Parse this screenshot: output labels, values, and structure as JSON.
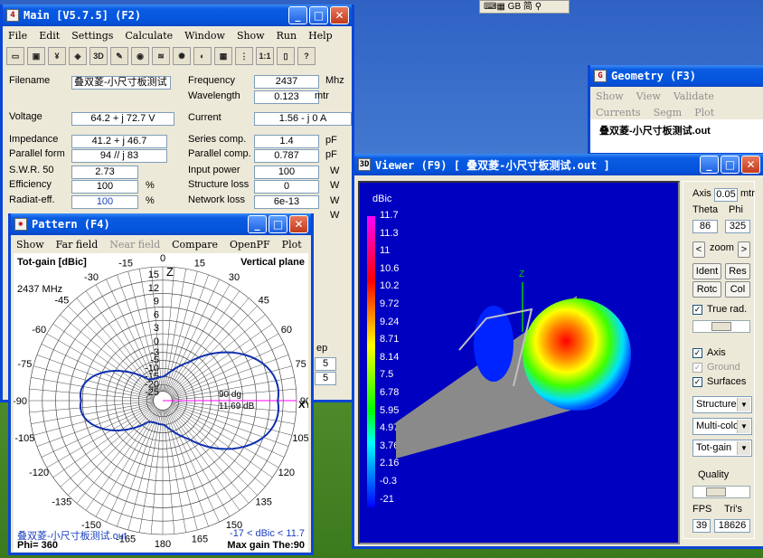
{
  "desktop": {
    "toolbar_text": "GB 简"
  },
  "main": {
    "title": "Main  [V5.7.5]    (F2)",
    "menu": [
      "File",
      "Edit",
      "Settings",
      "Calculate",
      "Window",
      "Show",
      "Run",
      "Help"
    ],
    "tools": [
      "open",
      "save",
      "ant",
      "box",
      "3D",
      "edit",
      "info",
      "wave",
      "pat",
      "map",
      "calc",
      "grid",
      "1:1",
      "book",
      "help"
    ],
    "filename_label": "Filename",
    "filename": "叠双菱-小尺寸板测试",
    "frequency_label": "Frequency",
    "frequency": "2437",
    "frequency_unit": "Mhz",
    "wavelength_label": "Wavelength",
    "wavelength": "0.123",
    "wavelength_unit": "mtr",
    "voltage_label": "Voltage",
    "voltage": "64.2 + j 72.7 V",
    "current_label": "Current",
    "current": "1.56 - j 0 A",
    "impedance_label": "Impedance",
    "impedance": "41.2 + j 46.7",
    "series_label": "Series comp.",
    "series": "1.4",
    "series_unit": "pF",
    "parallel_form_label": "Parallel form",
    "parallel_form": "94 // j 83",
    "parallel_comp_label": "Parallel comp.",
    "parallel_comp": "0.787",
    "parallel_unit": "pF",
    "swr_label": "S.W.R. 50",
    "swr": "2.73",
    "input_power_label": "Input power",
    "input_power": "100",
    "input_power_unit": "W",
    "efficiency_label": "Efficiency",
    "efficiency": "100",
    "efficiency_unit": "%",
    "structure_loss_label": "Structure loss",
    "structure_loss": "0",
    "structure_loss_unit": "W",
    "radiat_label": "Radiat-eff.",
    "radiat": "100",
    "radiat_unit": "%",
    "network_loss_label": "Network loss",
    "network_loss": "6e-13",
    "network_loss_unit": "W",
    "extra_unit": "W",
    "ep_label": "ep",
    "val5a": "5",
    "val5b": "5"
  },
  "geometry": {
    "title": "Geometry    (F3)",
    "menu": [
      "Show",
      "View",
      "Validate",
      "Currents",
      "Segm",
      "Plot"
    ],
    "file": "叠双菱-小尺寸板测试.out"
  },
  "viewer": {
    "title": "Viewer  (F9)      [  叠双菱-小尺寸板测试.out  ]",
    "scale_label": "dBic",
    "scale": [
      "11.7",
      "11.3",
      "11",
      "10.6",
      "10.2",
      "9.72",
      "9.24",
      "8.71",
      "8.14",
      "7.5",
      "6.78",
      "5.95",
      "4.97",
      "3.76",
      "2.16",
      "-0.3",
      "-21"
    ],
    "axis_label": "Axis",
    "axis_value": "0.05",
    "axis_unit": "mtr",
    "theta_label": "Theta",
    "phi_label": "Phi",
    "theta": "86",
    "phi": "325",
    "zoom_label": "zoom",
    "prev": "<",
    "next": ">",
    "ident": "Ident",
    "res": "Res",
    "rotc": "Rotc",
    "col": "Col",
    "true_rad": "True rad.",
    "axis_chk": "Axis",
    "ground": "Ground",
    "surfaces": "Surfaces",
    "sel_structure": "Structure",
    "sel_color": "Multi-colo",
    "sel_gain": "Tot-gain",
    "quality_label": "Quality",
    "fps_label": "FPS",
    "tris_label": "Tri's",
    "fps": "39",
    "tris": "18626",
    "z_label": "Z"
  },
  "pattern": {
    "title": "Pattern    (F4)",
    "menu": [
      "Show",
      "Far field",
      "Near field",
      "Compare",
      "OpenPF",
      "Plot"
    ],
    "gain_label": "Tot-gain [dBic]",
    "plane": "Vertical plane",
    "freq": "2437 MHz",
    "ring_labels": [
      "15",
      "12",
      "9",
      "6",
      "3",
      "0",
      "-3",
      "-5",
      "-10",
      "-15",
      "-20",
      "-25"
    ],
    "angle_labels": [
      "0",
      "15",
      "30",
      "45",
      "60",
      "75",
      "90",
      "105",
      "120",
      "135",
      "150",
      "165",
      "180",
      "-165",
      "-150",
      "-135",
      "-120",
      "-105",
      "-90",
      "-75",
      "-60",
      "-45",
      "-30",
      "-15"
    ],
    "z_label": "Z",
    "xy_label": "XY",
    "marker_angle": "90 dg",
    "marker_gain": "11.69 dB",
    "file": "叠双菱-小尺寸板测试.out",
    "range": "-17 < dBic < 11.7",
    "phi": "Phi= 360",
    "max_gain": "Max gain The:90"
  }
}
